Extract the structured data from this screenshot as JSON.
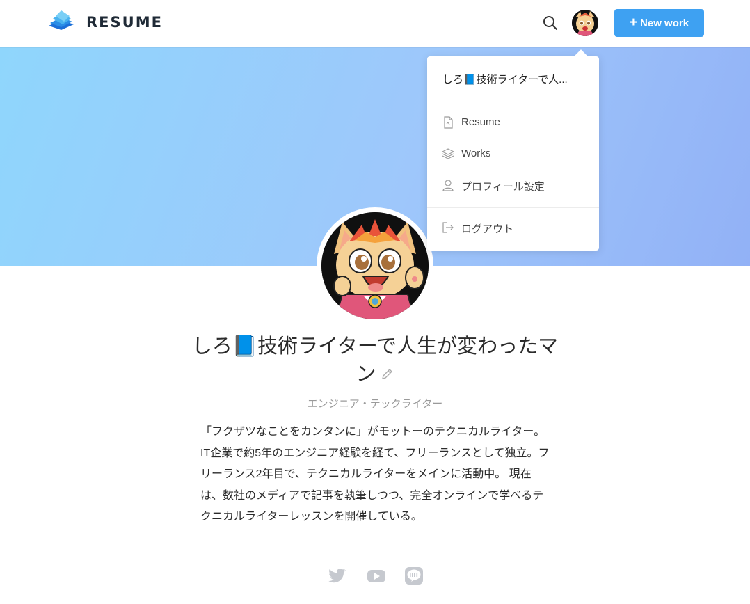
{
  "header": {
    "logo_text": "RESUME",
    "new_work_label": "New work",
    "new_work_icon": "plus-icon",
    "search_icon": "search-icon",
    "accent_color": "#3ea1f2"
  },
  "dropdown": {
    "user_name": "しろ📘技術ライターで人...",
    "items": [
      {
        "label": "Resume",
        "icon": "document-icon"
      },
      {
        "label": "Works",
        "icon": "layers-icon"
      },
      {
        "label": "プロフィール設定",
        "icon": "user-icon"
      },
      {
        "label": "ログアウト",
        "icon": "logout-icon"
      }
    ]
  },
  "profile": {
    "name": "しろ📘技術ライターで人生が変わったマン",
    "job_title": "エンジニア・テックライター",
    "bio": "「フクザツなことをカンタンに」がモットーのテクニカルライター。 IT企業で約5年のエンジニア経験を経て、フリーランスとして独立。フリーランス2年目で、テクニカルライターをメインに活動中。 現在は、数社のメディアで記事を執筆しつつ、完全オンラインで学べるテクニカルライターレッスンを開催している。",
    "social": [
      "twitter-icon",
      "youtube-icon",
      "line-icon"
    ]
  },
  "hero": {
    "gradient_start": "#8fd6fc",
    "gradient_end": "#92b1f6"
  }
}
